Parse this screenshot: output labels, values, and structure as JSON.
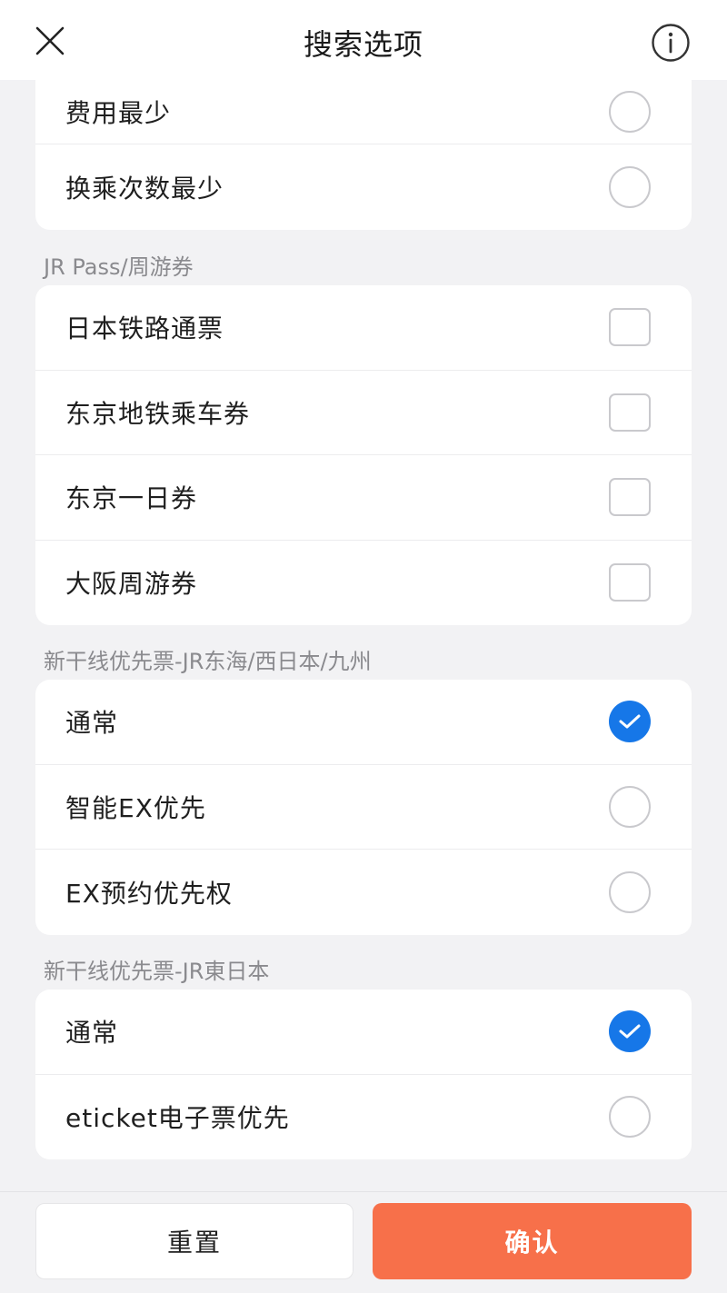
{
  "header": {
    "title": "搜索选项"
  },
  "sort_section": {
    "options": [
      {
        "label": "费用最少",
        "checked": false
      },
      {
        "label": "换乘次数最少",
        "checked": false
      }
    ]
  },
  "pass_section": {
    "title": "JR Pass/周游券",
    "options": [
      {
        "label": "日本铁路通票",
        "checked": false
      },
      {
        "label": "东京地铁乘车券",
        "checked": false
      },
      {
        "label": "东京一日券",
        "checked": false
      },
      {
        "label": "大阪周游券",
        "checked": false
      }
    ]
  },
  "shinkansen_west_section": {
    "title": "新干线优先票-JR东海/西日本/九州",
    "options": [
      {
        "label": "通常",
        "checked": true
      },
      {
        "label": "智能EX优先",
        "checked": false
      },
      {
        "label": "EX预约优先权",
        "checked": false
      }
    ]
  },
  "shinkansen_east_section": {
    "title": "新干线优先票-JR東日本",
    "options": [
      {
        "label": "通常",
        "checked": true
      },
      {
        "label": "eticket电子票优先",
        "checked": false
      }
    ]
  },
  "footer": {
    "reset_label": "重置",
    "confirm_label": "确认"
  },
  "colors": {
    "accent": "#1677e8",
    "confirm": "#f7704a",
    "background": "#f2f2f4"
  }
}
